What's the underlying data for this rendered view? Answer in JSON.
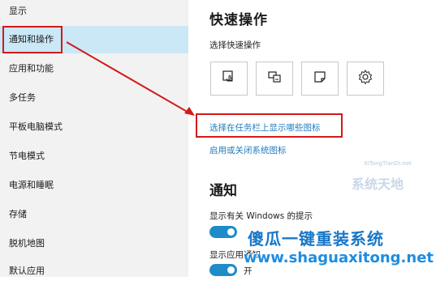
{
  "sidebar": {
    "items": [
      {
        "label": "显示"
      },
      {
        "label": "通知和操作"
      },
      {
        "label": "应用和功能"
      },
      {
        "label": "多任务"
      },
      {
        "label": "平板电脑模式"
      },
      {
        "label": "节电模式"
      },
      {
        "label": "电源和睡眠"
      },
      {
        "label": "存储"
      },
      {
        "label": "脱机地图"
      },
      {
        "label": "默认应用"
      }
    ],
    "selected_index": 1
  },
  "quick_actions": {
    "title": "快速操作",
    "subtitle": "选择快速操作",
    "tiles": [
      {
        "icon": "tablet-mode-icon"
      },
      {
        "icon": "project-icon"
      },
      {
        "icon": "note-icon"
      },
      {
        "icon": "settings-gear-icon"
      }
    ],
    "link_taskbar": "选择在任务栏上显示哪些图标",
    "link_system_icons": "启用或关闭系统图标"
  },
  "notifications": {
    "title": "通知",
    "toggle1_label": "显示有关 Windows 的提示",
    "toggle2_label": "显示应用通知",
    "toggle2_state": "开"
  },
  "watermark": {
    "line1": "傻瓜一键重装系统",
    "line2": "www.shaguaxitong.net",
    "logo_text": "系统天地",
    "logo_small": "XiTongTianDi.net"
  },
  "colors": {
    "accent": "#1e8cc8",
    "highlight_red": "#d21a1a",
    "selected_bg": "#cbe8f6",
    "link": "#1f7bbf"
  }
}
